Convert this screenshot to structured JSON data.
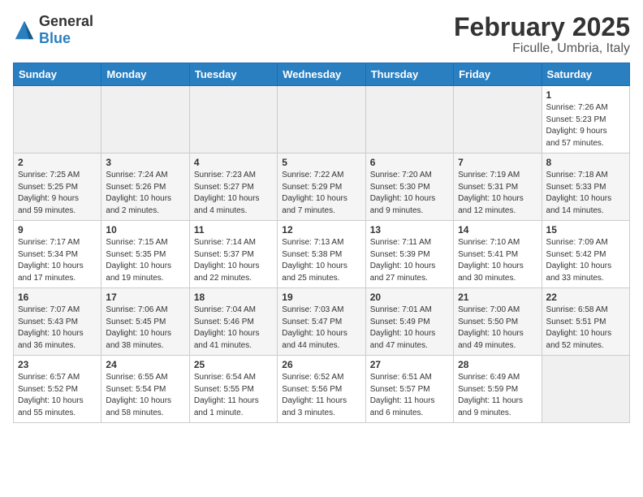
{
  "logo": {
    "general": "General",
    "blue": "Blue"
  },
  "title": "February 2025",
  "subtitle": "Ficulle, Umbria, Italy",
  "days_of_week": [
    "Sunday",
    "Monday",
    "Tuesday",
    "Wednesday",
    "Thursday",
    "Friday",
    "Saturday"
  ],
  "weeks": [
    [
      {
        "day": "",
        "info": ""
      },
      {
        "day": "",
        "info": ""
      },
      {
        "day": "",
        "info": ""
      },
      {
        "day": "",
        "info": ""
      },
      {
        "day": "",
        "info": ""
      },
      {
        "day": "",
        "info": ""
      },
      {
        "day": "1",
        "info": "Sunrise: 7:26 AM\nSunset: 5:23 PM\nDaylight: 9 hours\nand 57 minutes."
      }
    ],
    [
      {
        "day": "2",
        "info": "Sunrise: 7:25 AM\nSunset: 5:25 PM\nDaylight: 9 hours\nand 59 minutes."
      },
      {
        "day": "3",
        "info": "Sunrise: 7:24 AM\nSunset: 5:26 PM\nDaylight: 10 hours\nand 2 minutes."
      },
      {
        "day": "4",
        "info": "Sunrise: 7:23 AM\nSunset: 5:27 PM\nDaylight: 10 hours\nand 4 minutes."
      },
      {
        "day": "5",
        "info": "Sunrise: 7:22 AM\nSunset: 5:29 PM\nDaylight: 10 hours\nand 7 minutes."
      },
      {
        "day": "6",
        "info": "Sunrise: 7:20 AM\nSunset: 5:30 PM\nDaylight: 10 hours\nand 9 minutes."
      },
      {
        "day": "7",
        "info": "Sunrise: 7:19 AM\nSunset: 5:31 PM\nDaylight: 10 hours\nand 12 minutes."
      },
      {
        "day": "8",
        "info": "Sunrise: 7:18 AM\nSunset: 5:33 PM\nDaylight: 10 hours\nand 14 minutes."
      }
    ],
    [
      {
        "day": "9",
        "info": "Sunrise: 7:17 AM\nSunset: 5:34 PM\nDaylight: 10 hours\nand 17 minutes."
      },
      {
        "day": "10",
        "info": "Sunrise: 7:15 AM\nSunset: 5:35 PM\nDaylight: 10 hours\nand 19 minutes."
      },
      {
        "day": "11",
        "info": "Sunrise: 7:14 AM\nSunset: 5:37 PM\nDaylight: 10 hours\nand 22 minutes."
      },
      {
        "day": "12",
        "info": "Sunrise: 7:13 AM\nSunset: 5:38 PM\nDaylight: 10 hours\nand 25 minutes."
      },
      {
        "day": "13",
        "info": "Sunrise: 7:11 AM\nSunset: 5:39 PM\nDaylight: 10 hours\nand 27 minutes."
      },
      {
        "day": "14",
        "info": "Sunrise: 7:10 AM\nSunset: 5:41 PM\nDaylight: 10 hours\nand 30 minutes."
      },
      {
        "day": "15",
        "info": "Sunrise: 7:09 AM\nSunset: 5:42 PM\nDaylight: 10 hours\nand 33 minutes."
      }
    ],
    [
      {
        "day": "16",
        "info": "Sunrise: 7:07 AM\nSunset: 5:43 PM\nDaylight: 10 hours\nand 36 minutes."
      },
      {
        "day": "17",
        "info": "Sunrise: 7:06 AM\nSunset: 5:45 PM\nDaylight: 10 hours\nand 38 minutes."
      },
      {
        "day": "18",
        "info": "Sunrise: 7:04 AM\nSunset: 5:46 PM\nDaylight: 10 hours\nand 41 minutes."
      },
      {
        "day": "19",
        "info": "Sunrise: 7:03 AM\nSunset: 5:47 PM\nDaylight: 10 hours\nand 44 minutes."
      },
      {
        "day": "20",
        "info": "Sunrise: 7:01 AM\nSunset: 5:49 PM\nDaylight: 10 hours\nand 47 minutes."
      },
      {
        "day": "21",
        "info": "Sunrise: 7:00 AM\nSunset: 5:50 PM\nDaylight: 10 hours\nand 49 minutes."
      },
      {
        "day": "22",
        "info": "Sunrise: 6:58 AM\nSunset: 5:51 PM\nDaylight: 10 hours\nand 52 minutes."
      }
    ],
    [
      {
        "day": "23",
        "info": "Sunrise: 6:57 AM\nSunset: 5:52 PM\nDaylight: 10 hours\nand 55 minutes."
      },
      {
        "day": "24",
        "info": "Sunrise: 6:55 AM\nSunset: 5:54 PM\nDaylight: 10 hours\nand 58 minutes."
      },
      {
        "day": "25",
        "info": "Sunrise: 6:54 AM\nSunset: 5:55 PM\nDaylight: 11 hours\nand 1 minute."
      },
      {
        "day": "26",
        "info": "Sunrise: 6:52 AM\nSunset: 5:56 PM\nDaylight: 11 hours\nand 3 minutes."
      },
      {
        "day": "27",
        "info": "Sunrise: 6:51 AM\nSunset: 5:57 PM\nDaylight: 11 hours\nand 6 minutes."
      },
      {
        "day": "28",
        "info": "Sunrise: 6:49 AM\nSunset: 5:59 PM\nDaylight: 11 hours\nand 9 minutes."
      },
      {
        "day": "",
        "info": ""
      }
    ]
  ]
}
